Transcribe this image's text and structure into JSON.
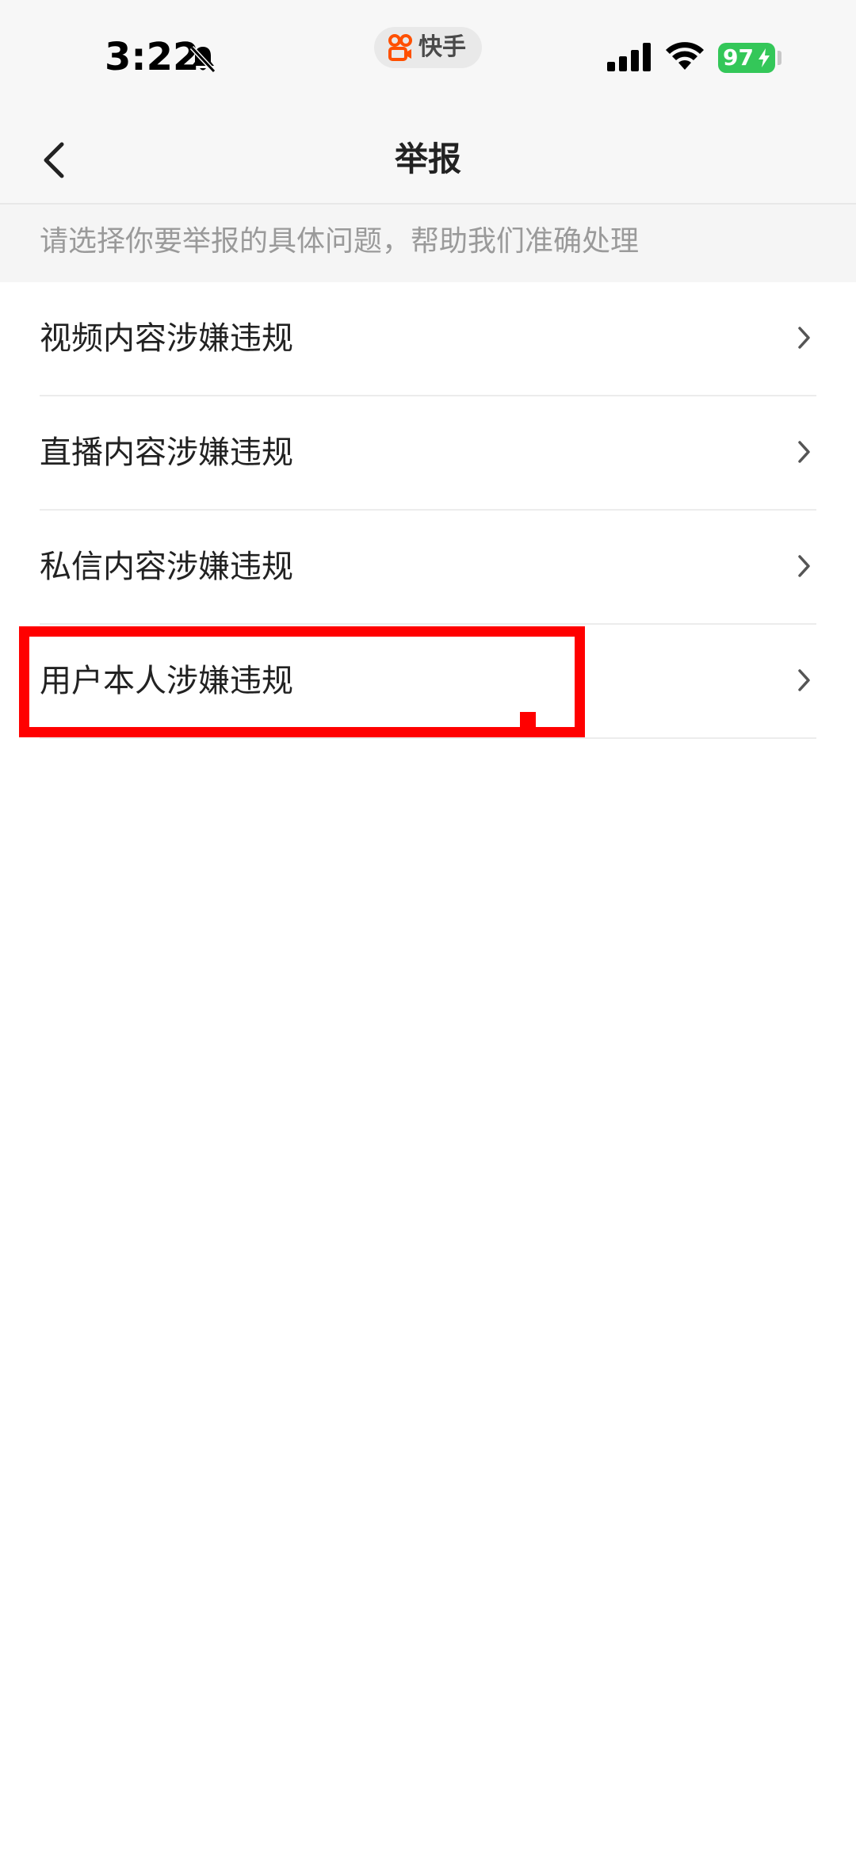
{
  "status_bar": {
    "time": "3:22",
    "app_name": "快手",
    "battery": "97",
    "icons": [
      "bell-slash-icon",
      "kuaishou-logo-icon",
      "signal-icon",
      "wifi-icon",
      "battery-icon",
      "bolt-icon"
    ],
    "colors": {
      "battery": "#34c759",
      "app_logo": "#ff5000"
    }
  },
  "nav": {
    "title": "举报",
    "back_icon": "chevron-left-icon"
  },
  "hint": {
    "text": "请选择你要举报的具体问题，帮助我们准确处理"
  },
  "report_options": [
    {
      "label": "视频内容涉嫌违规"
    },
    {
      "label": "直播内容涉嫌违规"
    },
    {
      "label": "私信内容涉嫌违规"
    },
    {
      "label": "用户本人涉嫌违规",
      "highlighted": true
    }
  ],
  "highlight_color": "#ff0000"
}
